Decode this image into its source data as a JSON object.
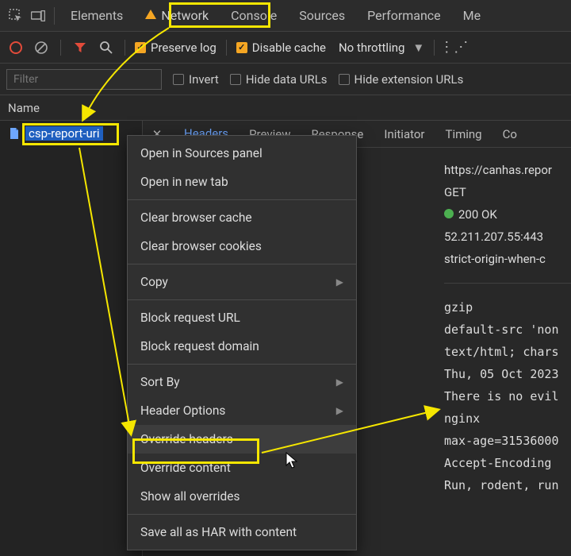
{
  "tabs": {
    "elements": "Elements",
    "network": "Network",
    "console": "Console",
    "sources": "Sources",
    "performance": "Performance",
    "memory": "Me"
  },
  "toolbar": {
    "preserve_log": "Preserve log",
    "disable_cache": "Disable cache",
    "throttling": "No throttling"
  },
  "filter": {
    "placeholder": "Filter",
    "invert": "Invert",
    "hide_data": "Hide data URLs",
    "hide_ext": "Hide extension URLs"
  },
  "colhead": {
    "name": "Name"
  },
  "request": {
    "name": "csp-report-uri"
  },
  "subtabs": {
    "headers": "Headers",
    "preview": "Preview",
    "response": "Response",
    "initiator": "Initiator",
    "timing": "Timing",
    "cookies": "Co"
  },
  "headers": {
    "url": "https://canhas.repor",
    "method": "GET",
    "status": "200 OK",
    "remote": "52.211.207.55:443",
    "referrer": "strict-origin-when-c"
  },
  "resp_headers": {
    "l1": "gzip",
    "l2": "default-src 'non",
    "l3": "text/html; chars",
    "l4": "Thu, 05 Oct 2023",
    "l5": "There is no evil",
    "l6": "nginx",
    "l7": "max-age=31536000",
    "l8": "Accept-Encoding",
    "l9": "Run, rodent, run"
  },
  "ctx": {
    "open_sources": "Open in Sources panel",
    "open_tab": "Open in new tab",
    "clear_cache": "Clear browser cache",
    "clear_cookies": "Clear browser cookies",
    "copy": "Copy",
    "block_url": "Block request URL",
    "block_domain": "Block request domain",
    "sort_by": "Sort By",
    "header_options": "Header Options",
    "override_headers": "Override headers",
    "override_content": "Override content",
    "show_overrides": "Show all overrides",
    "save_har": "Save all as HAR with content"
  }
}
